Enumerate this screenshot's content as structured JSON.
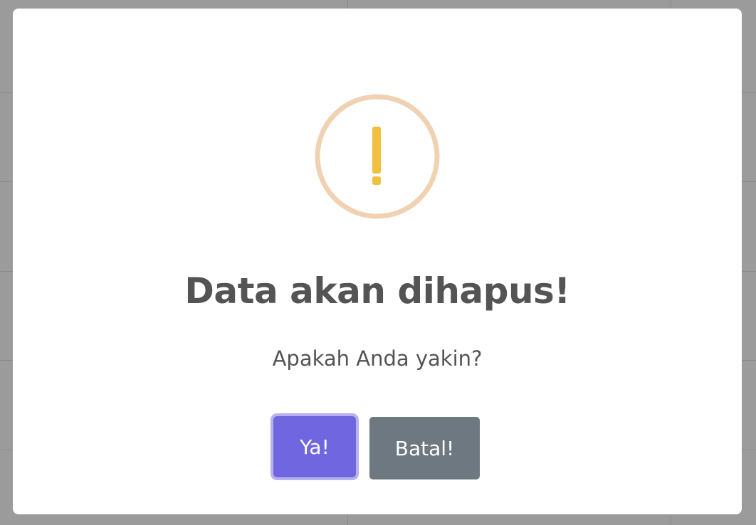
{
  "dialog": {
    "icon": "warning-icon",
    "title": "Data akan dihapus!",
    "message": "Apakah Anda yakin?",
    "confirm_label": "Ya!",
    "cancel_label": "Batal!"
  },
  "colors": {
    "backdrop": "#9b9b9b",
    "icon_ring": "#f0d2b3",
    "icon_mark": "#f1c040",
    "confirm": "#7066e0",
    "cancel": "#6e7881",
    "text": "#545454"
  }
}
